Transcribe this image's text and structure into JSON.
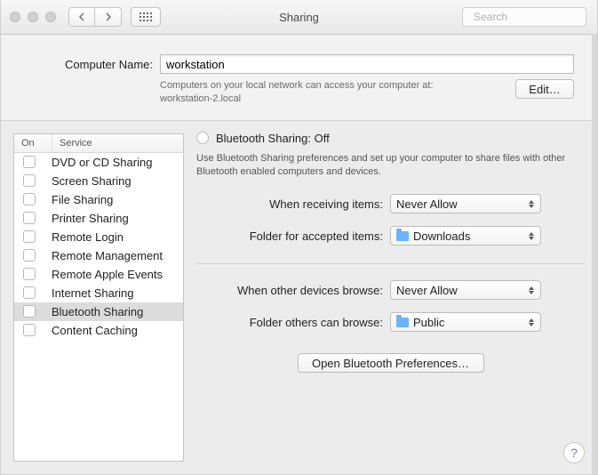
{
  "titlebar": {
    "title": "Sharing"
  },
  "search": {
    "placeholder": "Search"
  },
  "computer_name": {
    "label": "Computer Name:",
    "value": "workstation",
    "help_line1": "Computers on your local network can access your computer at:",
    "help_line2": "workstation-2.local",
    "edit_label": "Edit…"
  },
  "list": {
    "col_on": "On",
    "col_service": "Service",
    "items": [
      {
        "label": "DVD or CD Sharing"
      },
      {
        "label": "Screen Sharing"
      },
      {
        "label": "File Sharing"
      },
      {
        "label": "Printer Sharing"
      },
      {
        "label": "Remote Login"
      },
      {
        "label": "Remote Management"
      },
      {
        "label": "Remote Apple Events"
      },
      {
        "label": "Internet Sharing"
      },
      {
        "label": "Bluetooth Sharing"
      },
      {
        "label": "Content Caching"
      }
    ],
    "selected_index": 8
  },
  "detail": {
    "title": "Bluetooth Sharing: Off",
    "description": "Use Bluetooth Sharing preferences and set up your computer to share files with other Bluetooth enabled computers and devices.",
    "row1_label": "When receiving items:",
    "row1_value": "Never Allow",
    "row2_label": "Folder for accepted items:",
    "row2_value": "Downloads",
    "row3_label": "When other devices browse:",
    "row3_value": "Never Allow",
    "row4_label": "Folder others can browse:",
    "row4_value": "Public",
    "open_prefs_label": "Open Bluetooth Preferences…"
  },
  "help_glyph": "?"
}
